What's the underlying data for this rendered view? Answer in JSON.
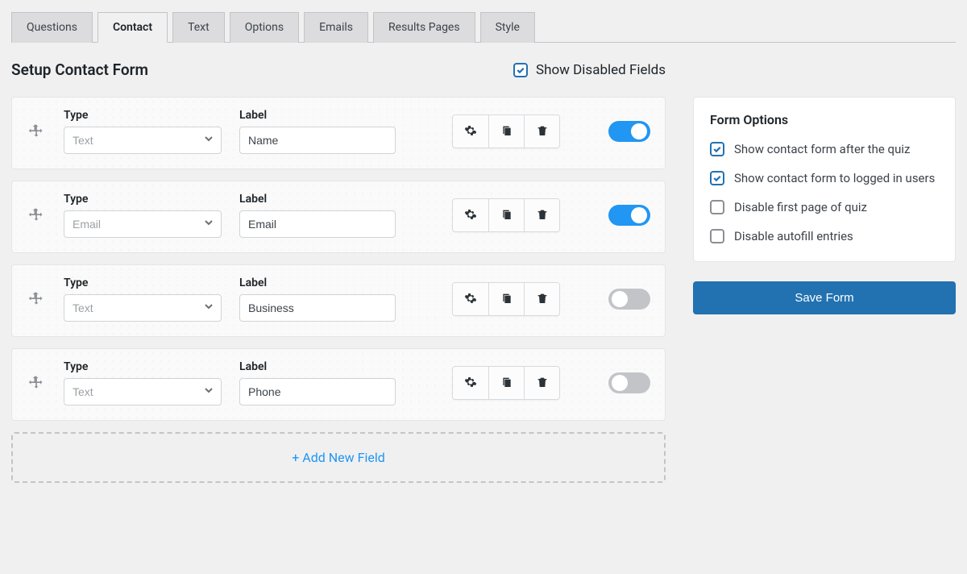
{
  "tabs": [
    "Questions",
    "Contact",
    "Text",
    "Options",
    "Emails",
    "Results Pages",
    "Style"
  ],
  "active_tab_index": 1,
  "page_title": "Setup Contact Form",
  "show_disabled_label": "Show Disabled Fields",
  "show_disabled_checked": true,
  "column_headers": {
    "type": "Type",
    "label": "Label"
  },
  "fields": [
    {
      "type": "Text",
      "label": "Name",
      "enabled": true
    },
    {
      "type": "Email",
      "label": "Email",
      "enabled": true
    },
    {
      "type": "Text",
      "label": "Business",
      "enabled": false
    },
    {
      "type": "Text",
      "label": "Phone",
      "enabled": false
    }
  ],
  "add_new_field_label": "+ Add New Field",
  "form_options": {
    "title": "Form Options",
    "items": [
      {
        "label": "Show contact form after the quiz",
        "checked": true
      },
      {
        "label": "Show contact form to logged in users",
        "checked": true
      },
      {
        "label": "Disable first page of quiz",
        "checked": false
      },
      {
        "label": "Disable autofill entries",
        "checked": false
      }
    ]
  },
  "save_button_label": "Save Form"
}
